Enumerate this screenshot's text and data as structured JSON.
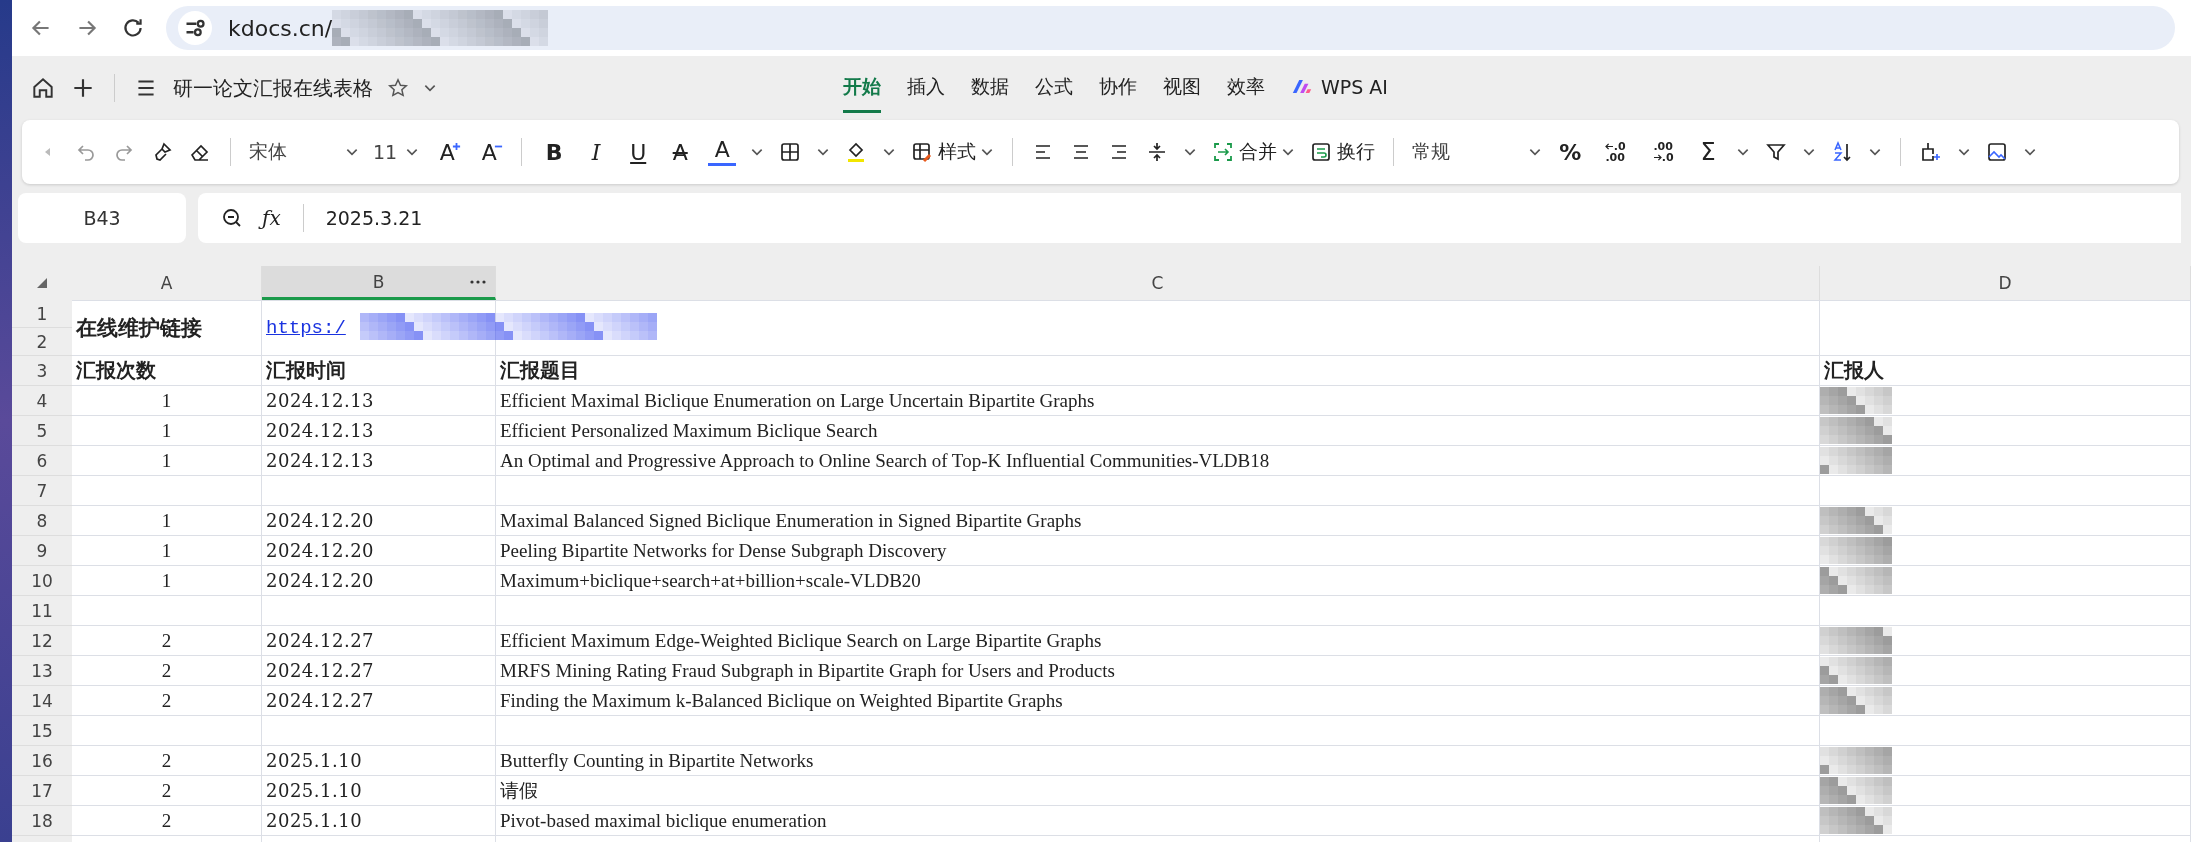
{
  "browser": {
    "address": "kdocs.cn/"
  },
  "doc": {
    "title": "研一论文汇报在线表格"
  },
  "menu_tabs": [
    {
      "label": "开始",
      "selected": true
    },
    {
      "label": "插入",
      "selected": false
    },
    {
      "label": "数据",
      "selected": false
    },
    {
      "label": "公式",
      "selected": false
    },
    {
      "label": "协作",
      "selected": false
    },
    {
      "label": "视图",
      "selected": false
    },
    {
      "label": "效率",
      "selected": false
    },
    {
      "label": "WPS AI",
      "selected": false
    }
  ],
  "toolbar": {
    "font": "宋体",
    "size": "11",
    "grow": "A",
    "shrink": "A",
    "bold": "B",
    "italic": "I",
    "underline": "U",
    "strike": "A",
    "font_color_letter": "A",
    "style": "样式",
    "merge": "合并",
    "wrap": "换行",
    "number_format": "常规",
    "percent": "%",
    "dec_inc_top": ".0",
    "dec_inc_bottom": ".00",
    "dec_dec_top": ".00",
    "dec_dec_bottom": ".0",
    "sum": "Σ"
  },
  "formula_bar": {
    "cell": "B43",
    "fx": "ƒx",
    "value": "2025.3.21"
  },
  "columns": [
    {
      "label": "A",
      "selected": false
    },
    {
      "label": "B",
      "selected": true
    },
    {
      "label": "C",
      "selected": false
    },
    {
      "label": "D",
      "selected": false
    }
  ],
  "link_row": {
    "numbers": [
      "1",
      "2"
    ],
    "label": "在线维护链接",
    "link": "https:/"
  },
  "header_row": {
    "number": "3",
    "cells": [
      "汇报次数",
      "汇报时间",
      "汇报题目",
      "汇报人"
    ]
  },
  "rows": [
    {
      "number": "4",
      "cells": [
        "1",
        "2024.12.13",
        "Efficient Maximal Biclique Enumeration on Large Uncertain Bipartite Graphs"
      ],
      "redacted": true
    },
    {
      "number": "5",
      "cells": [
        "1",
        "2024.12.13",
        "Efficient Personalized Maximum Biclique Search"
      ],
      "redacted": true
    },
    {
      "number": "6",
      "cells": [
        "1",
        "2024.12.13",
        "An Optimal and Progressive Approach to Online Search of Top-K Influential Communities-VLDB18"
      ],
      "redacted": true
    },
    {
      "number": "7",
      "cells": [
        "",
        "",
        ""
      ],
      "redacted": false
    },
    {
      "number": "8",
      "cells": [
        "1",
        "2024.12.20",
        "Maximal Balanced Signed Biclique Enumeration in Signed Bipartite Graphs"
      ],
      "redacted": true
    },
    {
      "number": "9",
      "cells": [
        "1",
        "2024.12.20",
        "Peeling Bipartite Networks for Dense Subgraph Discovery"
      ],
      "redacted": true
    },
    {
      "number": "10",
      "cells": [
        "1",
        "2024.12.20",
        "Maximum+biclique+search+at+billion+scale-VLDB20"
      ],
      "redacted": true
    },
    {
      "number": "11",
      "cells": [
        "",
        "",
        ""
      ],
      "redacted": false
    },
    {
      "number": "12",
      "cells": [
        "2",
        "2024.12.27",
        "Efficient Maximum Edge-Weighted Biclique Search on Large Bipartite Graphs"
      ],
      "redacted": true
    },
    {
      "number": "13",
      "cells": [
        "2",
        "2024.12.27",
        "MRFS Mining Rating Fraud Subgraph in Bipartite Graph for Users and Products"
      ],
      "redacted": true
    },
    {
      "number": "14",
      "cells": [
        "2",
        "2024.12.27",
        "Finding the Maximum k-Balanced Biclique on Weighted Bipartite Graphs"
      ],
      "redacted": true
    },
    {
      "number": "15",
      "cells": [
        "",
        "",
        ""
      ],
      "redacted": false
    },
    {
      "number": "16",
      "cells": [
        "2",
        "2025.1.10",
        "Butterfly Counting in Bipartite Networks"
      ],
      "redacted": true
    },
    {
      "number": "17",
      "cells": [
        "2",
        "2025.1.10",
        "请假"
      ],
      "redacted": true
    },
    {
      "number": "18",
      "cells": [
        "2",
        "2025.1.10",
        "Pivot-based maximal biclique enumeration"
      ],
      "redacted": true
    }
  ]
}
